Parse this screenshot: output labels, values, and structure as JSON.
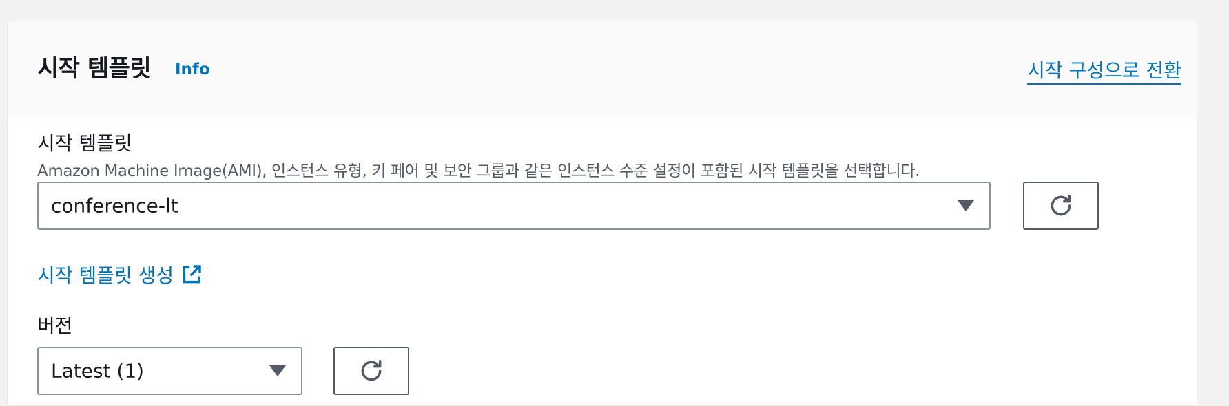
{
  "panel": {
    "title": "시작 템플릿",
    "info_label": "Info",
    "switch_link": "시작 구성으로 전환"
  },
  "launch_template": {
    "label": "시작 템플릿",
    "description": "Amazon Machine Image(AMI), 인스턴스 유형, 키 페어 및 보안 그룹과 같은 인스턴스 수준 설정이 포함된 시작 템플릿을 선택합니다.",
    "selected": "conference-lt",
    "create_link": "시작 템플릿 생성"
  },
  "version": {
    "label": "버전",
    "selected": "Latest (1)"
  },
  "colors": {
    "link": "#0073bb",
    "text": "#16191f",
    "secondary_text": "#545b64",
    "border": "#879596"
  },
  "icons": {
    "dropdown": "caret-down-icon",
    "refresh": "refresh-icon",
    "external": "external-link-icon"
  }
}
